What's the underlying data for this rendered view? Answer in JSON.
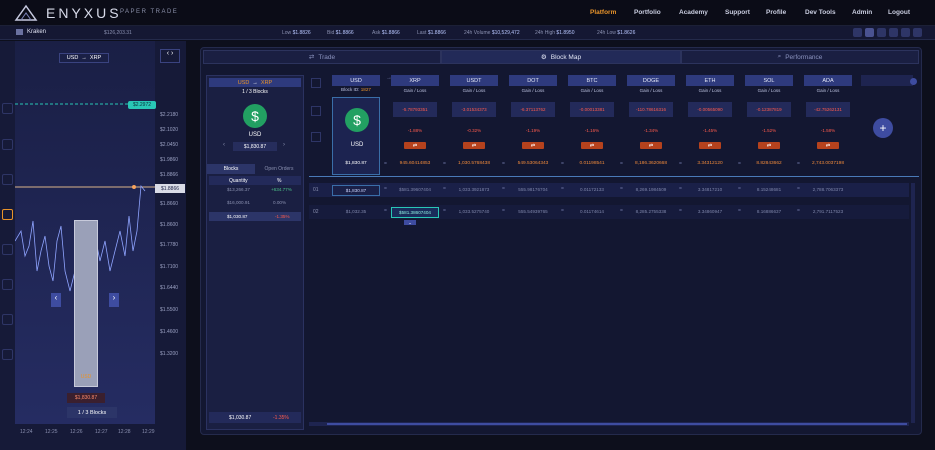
{
  "brand": {
    "name": "ENYXUS",
    "sub": "PAPER TRADE"
  },
  "nav": [
    "Platform",
    "Portfolio",
    "Academy",
    "Support",
    "Profile",
    "Dev Tools",
    "Admin",
    "Logout"
  ],
  "ticker": {
    "exchange": "Kraken",
    "balance": "$126,203.31",
    "low_label": "Low",
    "low": "$1.8826",
    "bid_label": "Bid",
    "bid": "$1.8866",
    "ask_label": "Ask",
    "ask": "$1.8866",
    "last_label": "Last",
    "last": "$1.8866",
    "vol_label": "24h Volume",
    "vol": "$10,529,472",
    "high_label": "24h High",
    "high": "$1.8950",
    "low24_label": "24h Low",
    "low24": "$1.8626"
  },
  "left": {
    "pair_from": "USD",
    "pair_to": "XRP",
    "arrow": "→",
    "price_tag": "$2.2972",
    "current_price": "$1.8866",
    "prices": [
      "$2.2180",
      "$2.1020",
      "$2.0450",
      "$1.9860",
      "$1.8866",
      "$1.8660",
      "$1.8600",
      "$1.7780",
      "$1.7100",
      "$1.6440",
      "$1.5500",
      "$1.4600",
      "$1.3200"
    ],
    "block_label": "USD",
    "block_value": "$1,830.87",
    "block_count": "1 / 3 Blocks",
    "times": [
      "12:24",
      "12:25",
      "12:26",
      "12:27",
      "12:28",
      "12:29"
    ]
  },
  "tabs": {
    "trade": "Trade",
    "blockmap": "Block Map",
    "performance": "Performance"
  },
  "pairpanel": {
    "from": "USD",
    "to": "XRP",
    "blocks": "1 / 3 Blocks",
    "coin": "USD",
    "value": "$1,830.87",
    "tab_blocks": "Blocks",
    "tab_orders": "Open Orders",
    "col_qty": "Quantity",
    "col_pct": "%",
    "rows": [
      {
        "v": "$13,266.37",
        "p": "+634.77%"
      },
      {
        "v": "$16,000.91",
        "p": "0.00%"
      },
      {
        "v": "$1,030.87",
        "p": "-1.35%"
      }
    ],
    "total": "$1,030.87",
    "total_pct": "-1.35%"
  },
  "usdcol": {
    "head": "USD",
    "block_id_label": "Block ID:",
    "block_id": "1827",
    "coin": "USD",
    "value": "$1,830.87"
  },
  "coins": [
    {
      "name": "XRP",
      "gl": "Gain / Loss",
      "val": "-5.78793351",
      "pct": "-1.88%",
      "amt": "945.60414853"
    },
    {
      "name": "USDT",
      "gl": "Gain / Loss",
      "val": "-3.01534373",
      "pct": "-0.32%",
      "amt": "1,030.5768438"
    },
    {
      "name": "DOT",
      "gl": "Gain / Loss",
      "val": "-6.37113762",
      "pct": "-1.19%",
      "amt": "549.53064343"
    },
    {
      "name": "BTC",
      "gl": "Gain / Loss",
      "val": "-0.00013381",
      "pct": "-1.16%",
      "amt": "0.01198541"
    },
    {
      "name": "DOGE",
      "gl": "Gain / Loss",
      "val": "-110.78616316",
      "pct": "-1.34%",
      "amt": "8,186.3620668"
    },
    {
      "name": "ETH",
      "gl": "Gain / Loss",
      "val": "-0.00565090",
      "pct": "-1.45%",
      "amt": "3.34312120"
    },
    {
      "name": "SOL",
      "gl": "Gain / Loss",
      "val": "-0.12387819",
      "pct": "-1.52%",
      "amt": "8.82843662"
    },
    {
      "name": "ADA",
      "gl": "Gain / Loss",
      "val": "-42.75262131",
      "pct": "-1.58%",
      "amt": "2,743.0037198"
    }
  ],
  "rows": [
    {
      "n": "01",
      "vals": [
        "$1,830.87",
        "$581.39607404",
        "1,033.3921873",
        "555.98176704",
        "0.01172133",
        "8,269.1984509",
        "3.34817210",
        "8.15248681",
        "2,788.7063373"
      ]
    },
    {
      "n": "02",
      "vals": [
        "$1,032.35",
        "$581.38607404",
        "1,033.5275740",
        "555.54939765",
        "0.01174614",
        "8,285.2755338",
        "3.34860947",
        "8.16886637",
        "2,791.7117523"
      ]
    }
  ]
}
